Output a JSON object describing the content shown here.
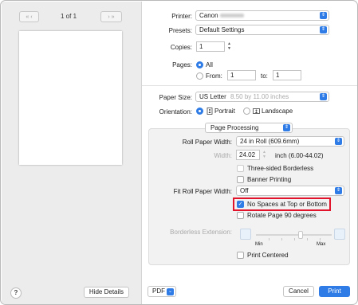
{
  "preview": {
    "nav_prev": "«  ‹",
    "nav_next": "›  »",
    "page_count": "1 of 1",
    "help_label": "?",
    "hide_details_label": "Hide Details"
  },
  "printer": {
    "label": "Printer:",
    "value": "Canon"
  },
  "presets": {
    "label": "Presets:",
    "value": "Default Settings"
  },
  "copies": {
    "label": "Copies:",
    "value": "1"
  },
  "pages": {
    "label": "Pages:",
    "all_label": "All",
    "from_label": "From:",
    "from_value": "1",
    "to_label": "to:",
    "to_value": "1"
  },
  "paper_size": {
    "label": "Paper Size:",
    "value": "US Letter",
    "dims": "8.50 by 11.00 inches"
  },
  "orientation": {
    "label": "Orientation:",
    "portrait_label": "Portrait",
    "landscape_label": "Landscape"
  },
  "section": {
    "value": "Page Processing"
  },
  "roll_paper_width": {
    "label": "Roll Paper Width:",
    "value": "24 in Roll (609.6mm)"
  },
  "width": {
    "label": "Width:",
    "value": "24.02",
    "unit_hint": "inch (6.00-44.02)"
  },
  "three_sided_label": "Three-sided Borderless",
  "banner_label": "Banner Printing",
  "fit_roll": {
    "label": "Fit Roll Paper Width:",
    "value": "Off"
  },
  "no_spaces_label": "No Spaces at Top or Bottom",
  "rotate_label": "Rotate Page 90 degrees",
  "borderless_ext": {
    "label": "Borderless Extension:",
    "min_label": "Min",
    "max_label": "Max"
  },
  "print_centered_label": "Print Centered",
  "footer": {
    "pdf_label": "PDF",
    "cancel_label": "Cancel",
    "print_label": "Print"
  },
  "colors": {
    "accent": "#2f7ce6",
    "highlight": "#e2142c"
  }
}
